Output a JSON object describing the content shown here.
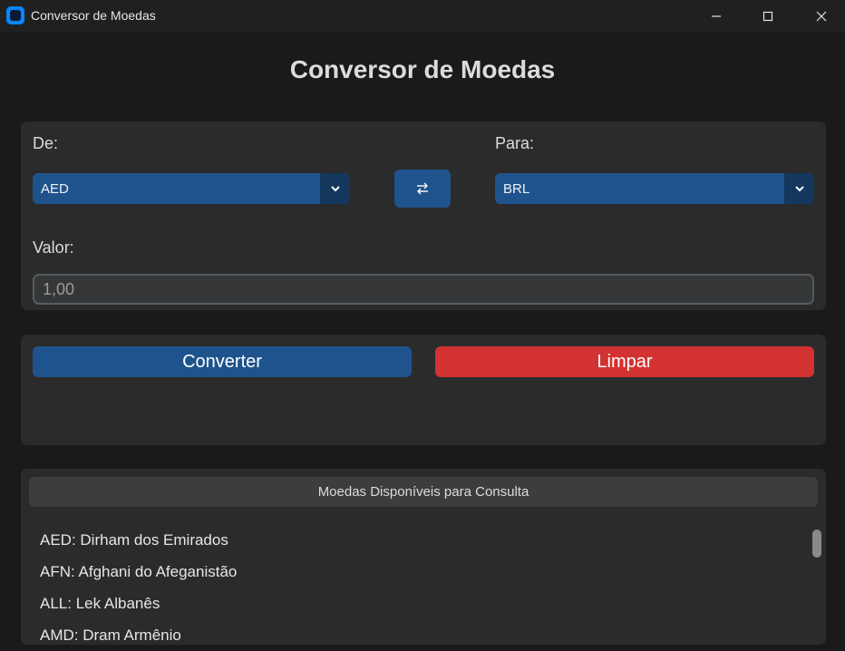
{
  "window": {
    "title": "Conversor de Moedas",
    "controls": {
      "minimize": "minimize",
      "maximize": "maximize",
      "close": "close"
    }
  },
  "header": {
    "title": "Conversor de Moedas"
  },
  "form": {
    "from_label": "De:",
    "from_value": "AED",
    "to_label": "Para:",
    "to_value": "BRL",
    "amount_label": "Valor:",
    "amount_value": "1,00"
  },
  "actions": {
    "convert_label": "Converter",
    "clear_label": "Limpar"
  },
  "currency_list": {
    "header": "Moedas Disponíveis para Consulta",
    "items": [
      "AED: Dirham dos Emirados",
      "AFN: Afghani do Afeganistão",
      "ALL: Lek Albanês",
      "AMD: Dram Armênio"
    ]
  },
  "colors": {
    "accent": "#1f538d",
    "danger": "#d33232",
    "panel": "#2b2b2b",
    "background": "#1a1a1a"
  },
  "icons": {
    "swap": "swap-arrows-icon",
    "dropdown": "chevron-down-icon"
  }
}
